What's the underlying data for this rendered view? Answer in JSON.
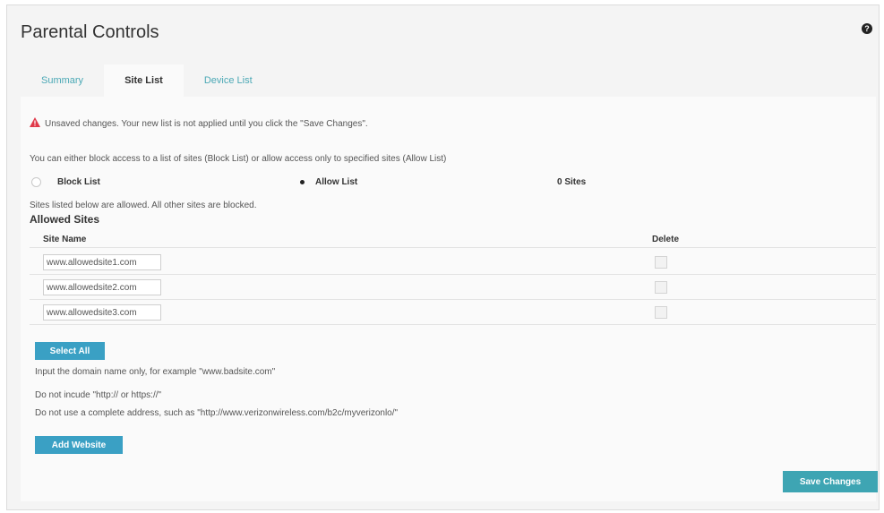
{
  "page": {
    "title": "Parental Controls",
    "help_icon": "help-icon"
  },
  "tabs": [
    {
      "label": "Summary",
      "active": false
    },
    {
      "label": "Site List",
      "active": true
    },
    {
      "label": "Device List",
      "active": false
    }
  ],
  "warning": {
    "icon": "warning-triangle-icon",
    "color": "#e0394a",
    "text": "Unsaved changes. Your new list is not applied until you click the \"Save Changes\"."
  },
  "intro_text": "You can either block access to a list of sites (Block List) or allow access only to specified sites (Allow List)",
  "mode": {
    "options": [
      {
        "label": "Block List",
        "selected": false
      },
      {
        "label": "Allow List",
        "selected": true
      }
    ],
    "count_text": "0 Sites"
  },
  "note": "Sites listed below are allowed. All other sites are blocked.",
  "section_title": "Allowed Sites",
  "table": {
    "headers": [
      "Site Name",
      "Delete"
    ],
    "rows": [
      {
        "site": "www.allowedsite1.com",
        "delete": false
      },
      {
        "site": "www.allowedsite2.com",
        "delete": false
      },
      {
        "site": "www.allowedsite3.com",
        "delete": false
      }
    ]
  },
  "buttons": {
    "select_all": "Select All",
    "add_website": "Add Website",
    "save_changes": "Save Changes"
  },
  "help_lines": [
    "Input the domain name only, for example \"www.badsite.com\"",
    "Do not incude \"http:// or https://\"",
    "Do not use a complete address, such as \"http://www.verizonwireless.com/b2c/myverizonlo/\""
  ],
  "colors": {
    "accent": "#3aa0c4",
    "tab_link": "#4aa8b5",
    "save_button": "#3ea5b3"
  }
}
